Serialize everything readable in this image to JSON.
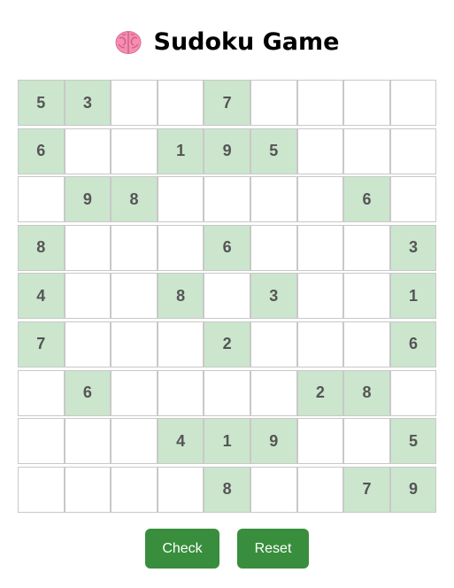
{
  "title": "Sudoku Game",
  "title_icon": "brain-icon",
  "colors": {
    "given_cell": "#cbe6cd",
    "empty_cell": "#ffffff",
    "cell_border": "#c8c8c8",
    "number": "#555555",
    "button": "#388e3c",
    "button_text": "#ffffff"
  },
  "board": [
    [
      "5",
      "3",
      "",
      "",
      "7",
      "",
      "",
      "",
      ""
    ],
    [
      "6",
      "",
      "",
      "1",
      "9",
      "5",
      "",
      "",
      ""
    ],
    [
      "",
      "9",
      "8",
      "",
      "",
      "",
      "",
      "6",
      ""
    ],
    [
      "8",
      "",
      "",
      "",
      "6",
      "",
      "",
      "",
      "3"
    ],
    [
      "4",
      "",
      "",
      "8",
      "",
      "3",
      "",
      "",
      "1"
    ],
    [
      "7",
      "",
      "",
      "",
      "2",
      "",
      "",
      "",
      "6"
    ],
    [
      "",
      "6",
      "",
      "",
      "",
      "",
      "2",
      "8",
      ""
    ],
    [
      "",
      "",
      "",
      "4",
      "1",
      "9",
      "",
      "",
      "5"
    ],
    [
      "",
      "",
      "",
      "",
      "8",
      "",
      "",
      "7",
      "9"
    ]
  ],
  "buttons": {
    "check_label": "Check",
    "reset_label": "Reset"
  }
}
